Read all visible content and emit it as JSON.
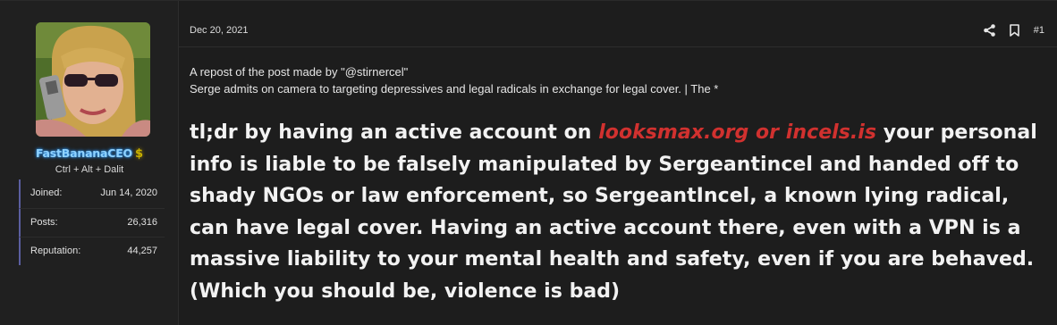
{
  "user": {
    "name": "FastBananaCEO",
    "badge": "$",
    "title": "Ctrl + Alt + Dalit",
    "stats": [
      {
        "label": "Joined:",
        "value": "Jun 14, 2020"
      },
      {
        "label": "Posts:",
        "value": "26,316"
      },
      {
        "label": "Reputation:",
        "value": "44,257"
      }
    ]
  },
  "post": {
    "date": "Dec 20, 2021",
    "number": "#1",
    "intro_line1": "A repost of the post made by \"@stirnercel\"",
    "intro_line2": "Serge admits on camera to targeting depressives and legal radicals in exchange for legal cover. | The *",
    "body_prefix": "tl;dr by having an active account on ",
    "body_highlight": "looksmax.org or incels.is",
    "body_suffix": " your personal info is liable to be falsely manipulated by Sergeantincel and handed off to shady NGOs or law enforcement, so SergeantIncel, a known lying radical, can have legal cover. Having an active account there, even with a VPN is a massive liability to your mental health and safety, even if you are behaved. (Which you should be, violence is bad)"
  },
  "icons": {
    "share": "share-icon",
    "bookmark": "bookmark-icon"
  },
  "colors": {
    "background": "#1b1b1b",
    "username": "#8fd2ff",
    "highlight": "#d1312f",
    "stat_accent": "#5b5ea0"
  }
}
